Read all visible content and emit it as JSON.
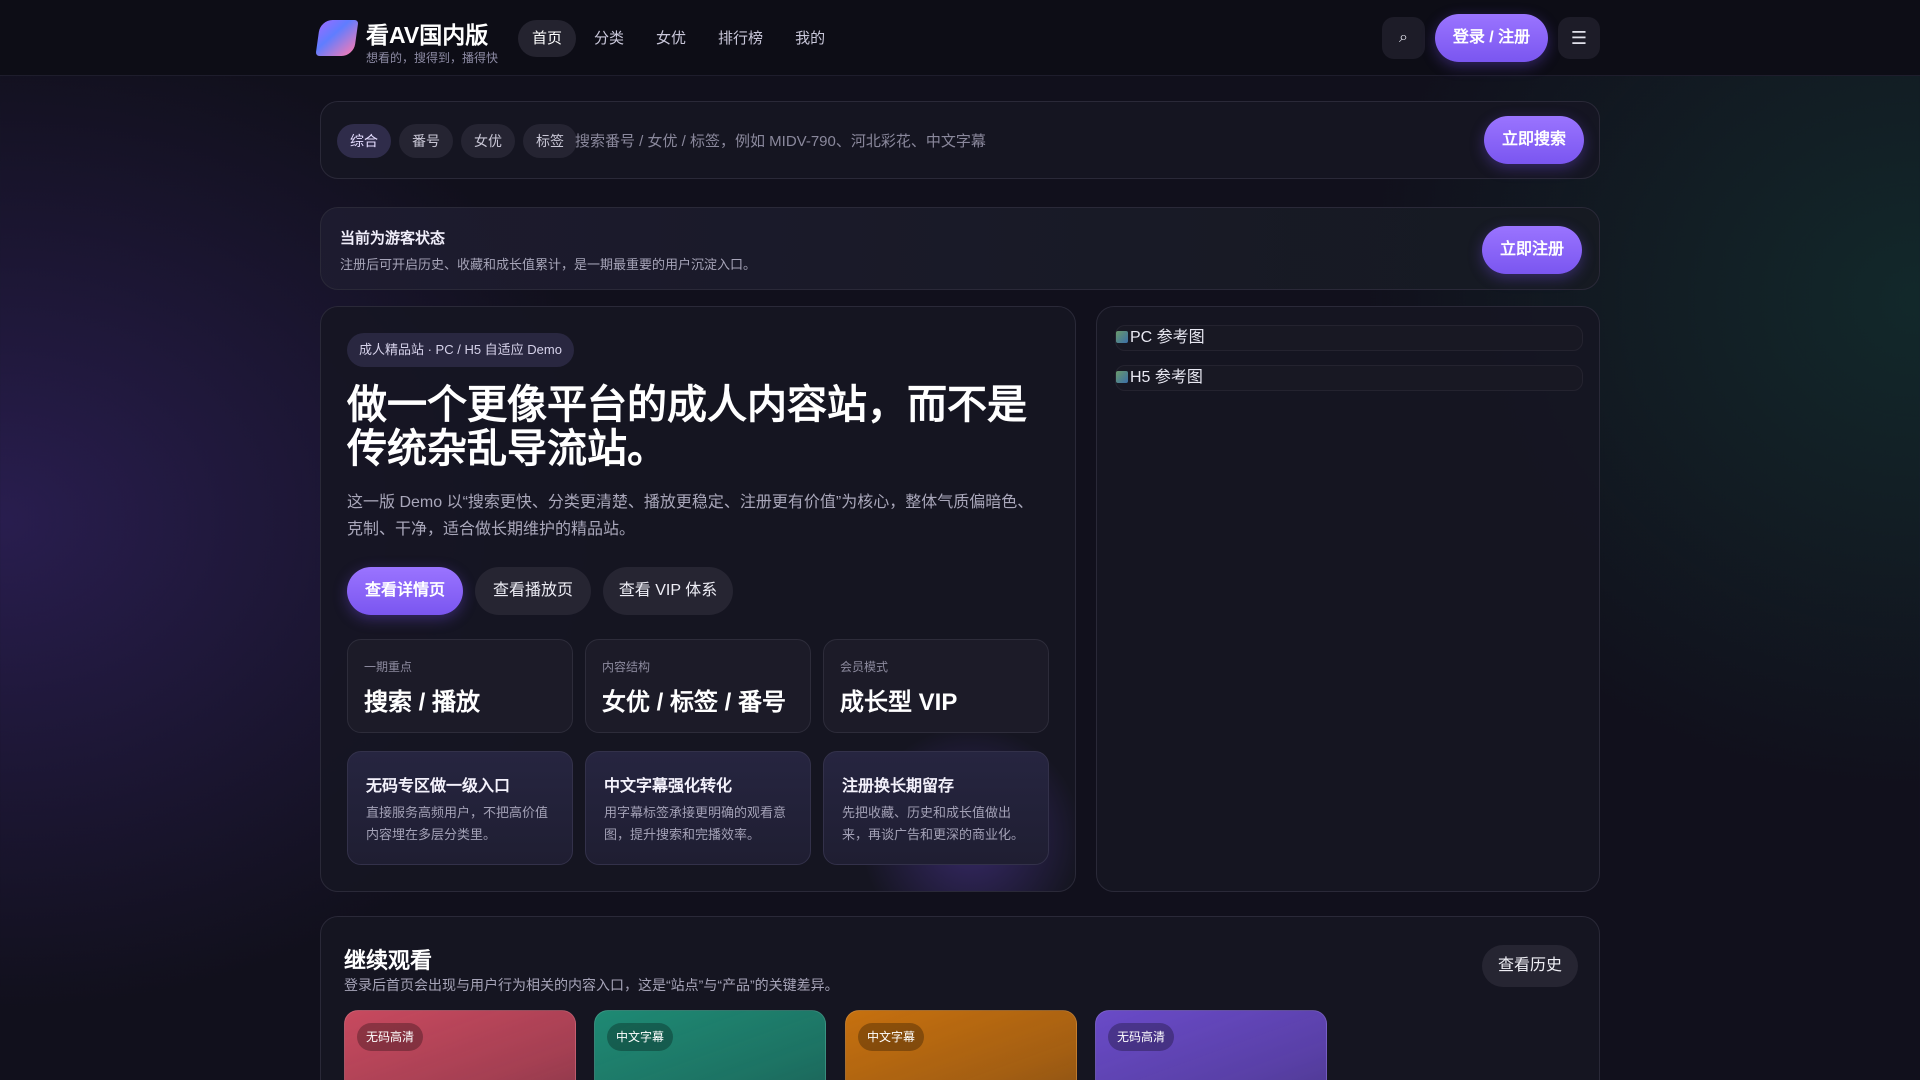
{
  "header": {
    "brand_title": "看AV国内版",
    "brand_subtitle": "想看的，搜得到，播得快",
    "nav": [
      {
        "label": "首页",
        "active": true
      },
      {
        "label": "分类"
      },
      {
        "label": "女优"
      },
      {
        "label": "排行榜"
      },
      {
        "label": "我的"
      }
    ],
    "search_icon": "⌕",
    "login_label": "登录 / 注册",
    "menu_icon": "☰"
  },
  "search": {
    "tabs": [
      {
        "label": "综合",
        "active": true
      },
      {
        "label": "番号"
      },
      {
        "label": "女优"
      },
      {
        "label": "标签"
      }
    ],
    "placeholder": "搜索番号 / 女优 / 标签，例如 MIDV-790、河北彩花、中文字幕",
    "submit_label": "立即搜索"
  },
  "guest": {
    "title": "当前为游客状态",
    "desc": "注册后可开启历史、收藏和成长值累计，是一期最重要的用户沉淀入口。",
    "button": "立即注册"
  },
  "hero": {
    "pill": "成人精品站 · PC / H5 自适应 Demo",
    "title": "做一个更像平台的成人内容站，而不是传统杂乱导流站。",
    "desc": "这一版 Demo 以“搜索更快、分类更清楚、播放更稳定、注册更有价值”为核心，整体气质偏暗色、克制、干净，适合做长期维护的精品站。",
    "buttons": [
      "查看详情页",
      "查看播放页",
      "查看 VIP 体系"
    ],
    "stats": [
      {
        "label": "一期重点",
        "value": "搜索 / 播放"
      },
      {
        "label": "内容结构",
        "value": "女优 / 标签 / 番号"
      },
      {
        "label": "会员模式",
        "value": "成长型 VIP"
      }
    ],
    "features": [
      {
        "title": "无码专区做一级入口",
        "desc": "直接服务高频用户，不把高价值内容埋在多层分类里。"
      },
      {
        "title": "中文字幕强化转化",
        "desc": "用字幕标签承接更明确的观看意图，提升搜索和完播效率。"
      },
      {
        "title": "注册换长期留存",
        "desc": "先把收藏、历史和成长值做出来，再谈广告和更深的商业化。"
      }
    ]
  },
  "refs": {
    "pc": "PC 参考图",
    "h5": "H5 参考图"
  },
  "continue_watching": {
    "title": "继续观看",
    "desc": "登录后首页会出现与用户行为相关的内容入口，这是“站点”与“产品”的关键差异。",
    "history_button": "查看历史",
    "items": [
      {
        "badge": "无码高清",
        "color": "#c84a5f"
      },
      {
        "badge": "中文字幕",
        "color": "#1f8a74"
      },
      {
        "badge": "中文字幕",
        "color": "#c7710f"
      },
      {
        "badge": "无码高清",
        "color": "#6a4bc8"
      }
    ]
  }
}
